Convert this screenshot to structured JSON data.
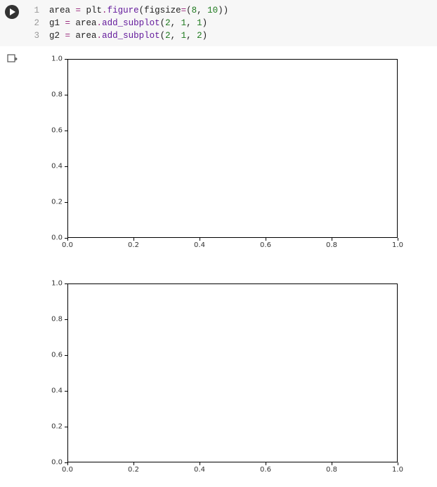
{
  "code": {
    "lines": [
      {
        "num": "1",
        "tokens": [
          {
            "t": "area ",
            "c": ""
          },
          {
            "t": "=",
            "c": "tok-op"
          },
          {
            "t": " plt",
            "c": ""
          },
          {
            "t": ".",
            "c": "tok-op"
          },
          {
            "t": "figure",
            "c": "tok-fn"
          },
          {
            "t": "(figsize",
            "c": ""
          },
          {
            "t": "=",
            "c": "tok-op"
          },
          {
            "t": "(",
            "c": ""
          },
          {
            "t": "8",
            "c": "tok-num"
          },
          {
            "t": ", ",
            "c": ""
          },
          {
            "t": "10",
            "c": "tok-num"
          },
          {
            "t": "))",
            "c": ""
          }
        ]
      },
      {
        "num": "2",
        "tokens": [
          {
            "t": "g1 ",
            "c": ""
          },
          {
            "t": "=",
            "c": "tok-op"
          },
          {
            "t": " area",
            "c": ""
          },
          {
            "t": ".",
            "c": "tok-op"
          },
          {
            "t": "add_subplot",
            "c": "tok-fn"
          },
          {
            "t": "(",
            "c": ""
          },
          {
            "t": "2",
            "c": "tok-num"
          },
          {
            "t": ", ",
            "c": ""
          },
          {
            "t": "1",
            "c": "tok-num"
          },
          {
            "t": ", ",
            "c": ""
          },
          {
            "t": "1",
            "c": "tok-num"
          },
          {
            "t": ")",
            "c": ""
          }
        ]
      },
      {
        "num": "3",
        "tokens": [
          {
            "t": "g2 ",
            "c": ""
          },
          {
            "t": "=",
            "c": "tok-op"
          },
          {
            "t": " area",
            "c": ""
          },
          {
            "t": ".",
            "c": "tok-op"
          },
          {
            "t": "add_subplot",
            "c": "tok-fn"
          },
          {
            "t": "(",
            "c": ""
          },
          {
            "t": "2",
            "c": "tok-num"
          },
          {
            "t": ", ",
            "c": ""
          },
          {
            "t": "1",
            "c": "tok-num"
          },
          {
            "t": ", ",
            "c": ""
          },
          {
            "t": "2",
            "c": "tok-num"
          },
          {
            "t": ")",
            "c": ""
          }
        ]
      }
    ]
  },
  "chart_data": [
    {
      "type": "line",
      "series": [],
      "xlim": [
        0.0,
        1.0
      ],
      "ylim": [
        0.0,
        1.0
      ],
      "xticks": [
        "0.0",
        "0.2",
        "0.4",
        "0.6",
        "0.8",
        "1.0"
      ],
      "yticks": [
        "0.0",
        "0.2",
        "0.4",
        "0.6",
        "0.8",
        "1.0"
      ],
      "title": "",
      "xlabel": "",
      "ylabel": ""
    },
    {
      "type": "line",
      "series": [],
      "xlim": [
        0.0,
        1.0
      ],
      "ylim": [
        0.0,
        1.0
      ],
      "xticks": [
        "0.0",
        "0.2",
        "0.4",
        "0.6",
        "0.8",
        "1.0"
      ],
      "yticks": [
        "0.0",
        "0.2",
        "0.4",
        "0.6",
        "0.8",
        "1.0"
      ],
      "title": "",
      "xlabel": "",
      "ylabel": ""
    }
  ]
}
